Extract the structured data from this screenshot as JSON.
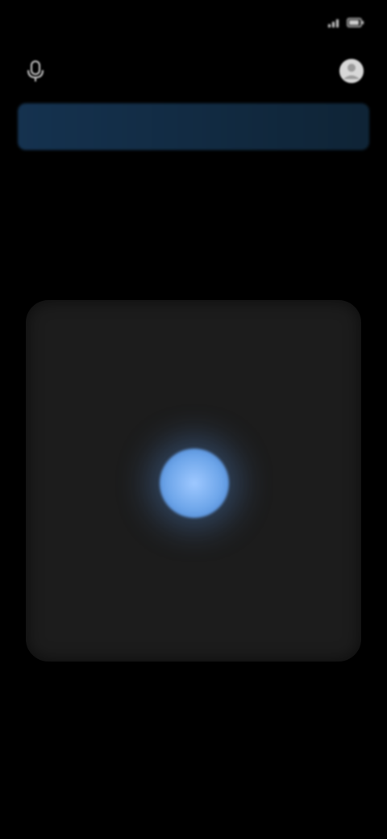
{
  "status_bar": {
    "time": "",
    "right_text": ""
  },
  "app_bar": {
    "title": "",
    "left_icon": "mic-icon",
    "right_icon": "profile-icon"
  },
  "banner": {
    "text": ""
  },
  "prompt": {
    "text": ""
  },
  "record": {
    "icon": "record-icon"
  },
  "colors": {
    "background": "#000000",
    "card": "#1c1c1c",
    "banner": "#15324f",
    "accent": "#6ea6ea"
  }
}
